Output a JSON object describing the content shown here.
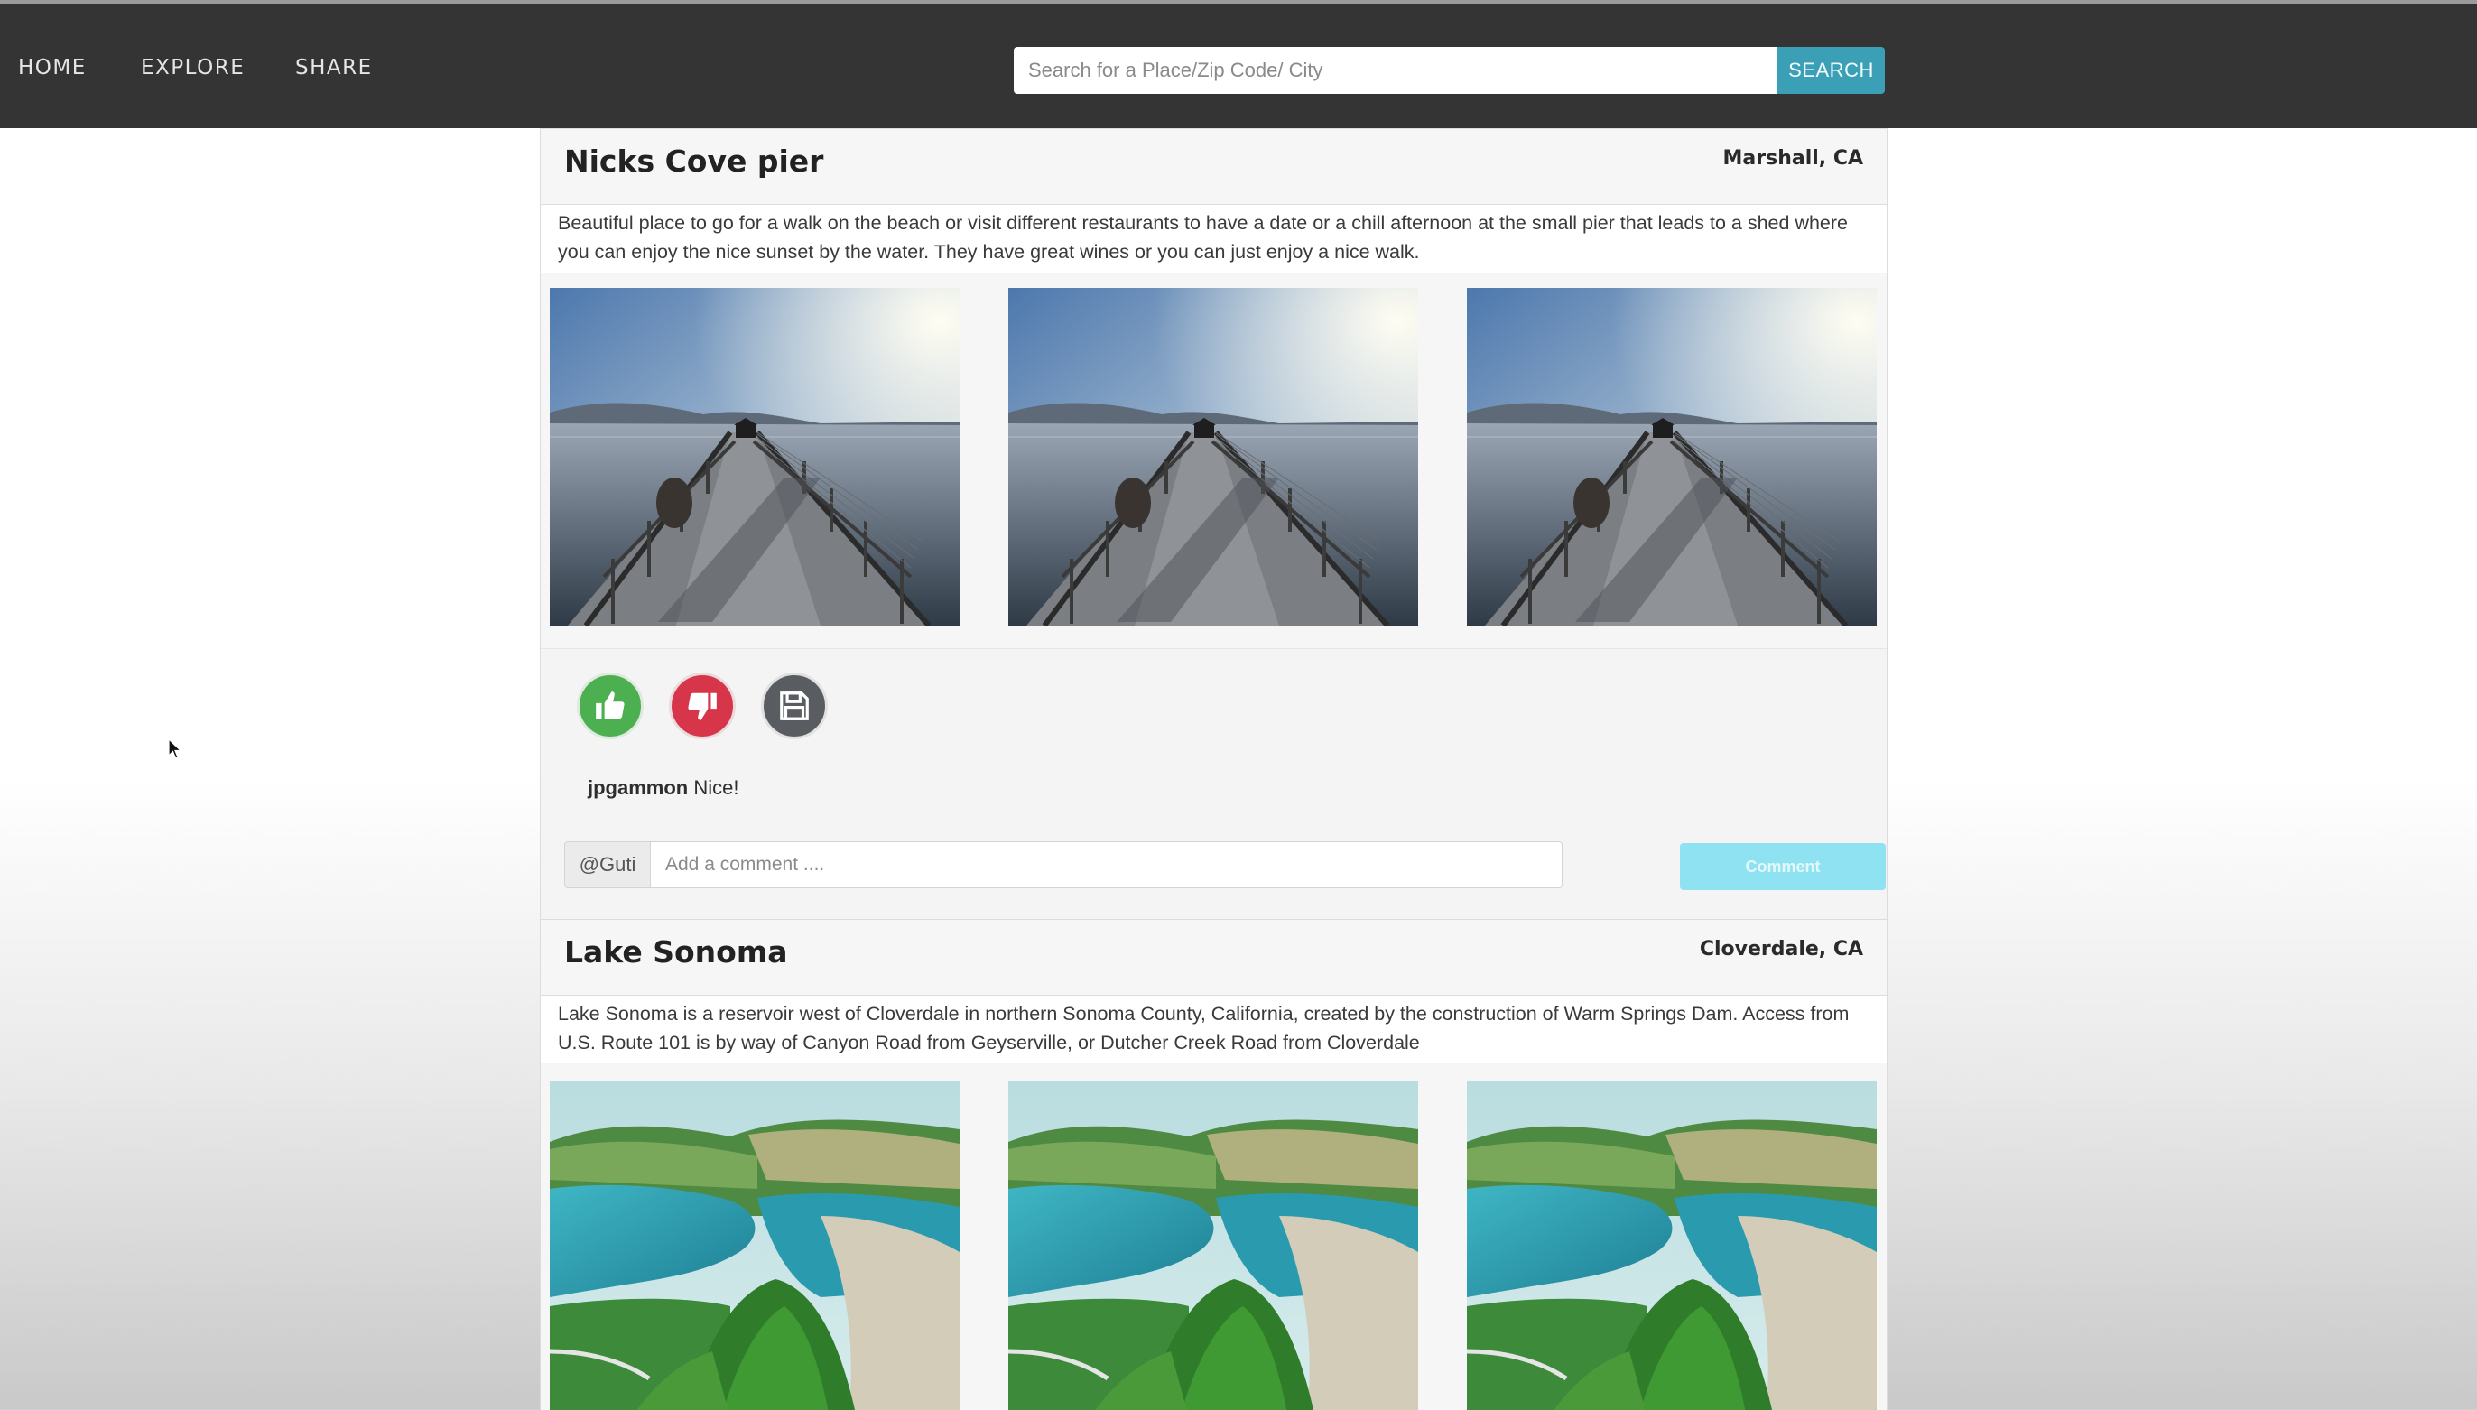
{
  "nav": {
    "home": "HOME",
    "explore": "EXPLORE",
    "share": "SHARE"
  },
  "search": {
    "placeholder": "Search for a Place/Zip Code/ City",
    "button_label": "SEARCH"
  },
  "posts": [
    {
      "title": "Nicks Cove pier",
      "location": "Marshall, CA",
      "description": "Beautiful place to go for a walk on the beach or visit different restaurants to have a date or a chill afternoon at the small pier that leads to a shed where you can enjoy the nice sunset by the water. They have great wines or you can just enjoy a nice walk.",
      "photo_icon": "pier-photo",
      "actions": {
        "like_icon": "thumbs-up-icon",
        "dislike_icon": "thumbs-down-icon",
        "save_icon": "floppy-disk-icon"
      },
      "comments": [
        {
          "user": "jpgammon",
          "text": "Nice!"
        }
      ],
      "comment_form": {
        "prefix": "@Guti",
        "placeholder": "Add a comment ....",
        "button_label": "Comment"
      }
    },
    {
      "title": "Lake Sonoma",
      "location": "Cloverdale, CA",
      "description": "Lake Sonoma is a reservoir west of Cloverdale in northern Sonoma County, California, created by the construction of Warm Springs Dam. Access from U.S. Route 101 is by way of Canyon Road from Geyserville, or Dutcher Creek Road from Cloverdale",
      "photo_icon": "lake-photo"
    }
  ],
  "colors": {
    "navbar": "#343434",
    "search_button": "#3b9fb6",
    "like": "#4caf50",
    "dislike": "#d7354a",
    "save": "#595d61",
    "comment_button": "#8fe2f2"
  }
}
